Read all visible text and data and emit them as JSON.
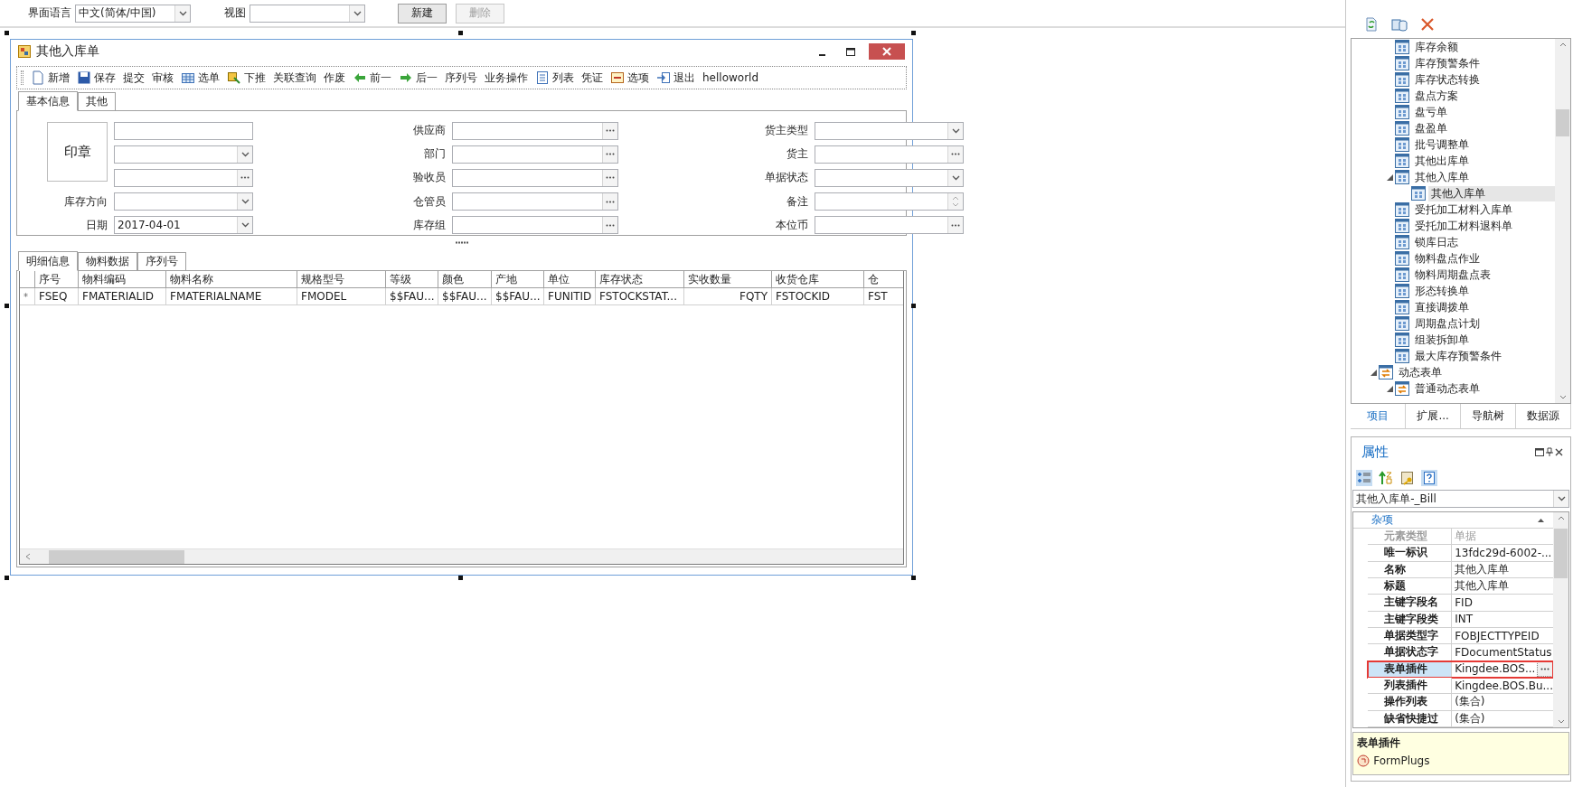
{
  "top_bar": {
    "language_label": "界面语言",
    "language_value": "中文(简体/中国)",
    "view_label": "视图",
    "buttons": [
      {
        "label": "新建",
        "disabled": false
      },
      {
        "label": "删除",
        "disabled": true
      }
    ]
  },
  "form_window": {
    "title": "其他入库单",
    "toolbar": [
      {
        "label": "新增",
        "kind": "document"
      },
      {
        "label": "保存",
        "kind": "disk"
      },
      {
        "label": "提交",
        "kind": "plain"
      },
      {
        "label": "审核",
        "kind": "plain"
      },
      {
        "label": "选单",
        "kind": "grid"
      },
      {
        "label": "下推",
        "kind": "push"
      },
      {
        "label": "关联查询",
        "kind": "plain"
      },
      {
        "label": "作废",
        "kind": "plain"
      },
      {
        "label": "前一",
        "kind": "back"
      },
      {
        "label": "后一",
        "kind": "forward"
      },
      {
        "label": "序列号",
        "kind": "plain"
      },
      {
        "label": "业务操作",
        "kind": "plain"
      },
      {
        "label": "列表",
        "kind": "list"
      },
      {
        "label": "凭证",
        "kind": "plain"
      },
      {
        "label": "选项",
        "kind": "options"
      },
      {
        "label": "退出",
        "kind": "exit"
      },
      {
        "label": "helloworld",
        "kind": "plain"
      }
    ],
    "tabs": [
      {
        "label": "基本信息",
        "selected": true
      },
      {
        "label": "其他",
        "selected": false
      }
    ],
    "stamp": "印章",
    "field_columns": [
      [
        {
          "kind": "text"
        },
        {
          "kind": "combo"
        },
        {
          "kind": "lookup"
        },
        {
          "label": "库存方向",
          "kind": "combo"
        },
        {
          "label": "日期",
          "kind": "combo",
          "value": "2017-04-01"
        }
      ],
      [
        {
          "label": "供应商",
          "kind": "lookup"
        },
        {
          "label": "部门",
          "kind": "lookup"
        },
        {
          "label": "验收员",
          "kind": "lookup"
        },
        {
          "label": "仓管员",
          "kind": "lookup"
        },
        {
          "label": "库存组",
          "kind": "lookup"
        }
      ],
      [
        {
          "label": "货主类型",
          "kind": "combo"
        },
        {
          "label": "货主",
          "kind": "lookup"
        },
        {
          "label": "单据状态",
          "kind": "combo"
        },
        {
          "label": "备注",
          "kind": "spin"
        },
        {
          "label": "本位币",
          "kind": "lookup"
        }
      ]
    ],
    "detail_tabs": [
      {
        "label": "明细信息",
        "selected": true
      },
      {
        "label": "物料数据",
        "selected": false
      },
      {
        "label": "序列号",
        "selected": false
      }
    ],
    "grid": {
      "columns": [
        "序号",
        "物料编码",
        "物料名称",
        "规格型号",
        "等级",
        "颜色",
        "产地",
        "单位",
        "库存状态",
        "实收数量",
        "收货仓库",
        "仓"
      ],
      "rows": [
        {
          "marker": "*",
          "cells": [
            "FSEQ",
            "FMATERIALID",
            "FMATERIALNAME",
            "FMODEL",
            "$$FAU...",
            "$$FAU...",
            "$$FAU...",
            "FUNITID",
            "FSTOCKSTAT...",
            "FQTY",
            "FSTOCKID",
            "FST"
          ]
        }
      ]
    }
  },
  "explorer": {
    "tree": {
      "partial_branch": [
        {
          "label": "库存余额",
          "kind": "bill",
          "selected": false
        },
        {
          "label": "库存预警条件",
          "kind": "bill",
          "selected": false
        },
        {
          "label": "库存状态转换",
          "kind": "bill",
          "selected": false
        },
        {
          "label": "盘点方案",
          "kind": "bill",
          "selected": false
        },
        {
          "label": "盘亏单",
          "kind": "bill",
          "selected": false
        },
        {
          "label": "盘盈单",
          "kind": "bill",
          "selected": false
        },
        {
          "label": "批号调整单",
          "kind": "bill",
          "selected": false
        },
        {
          "label": "其他出库单",
          "kind": "bill",
          "selected": false
        },
        {
          "label": "其他入库单",
          "kind": "bill",
          "selected": false,
          "expanded": true,
          "children": [
            {
              "label": "其他入库单",
              "kind": "bill",
              "selected": true
            }
          ]
        },
        {
          "label": "受托加工材料入库单",
          "kind": "bill",
          "selected": false
        },
        {
          "label": "受托加工材料退料单",
          "kind": "bill",
          "selected": false
        },
        {
          "label": "锁库日志",
          "kind": "bill",
          "selected": false
        },
        {
          "label": "物料盘点作业",
          "kind": "bill",
          "selected": false
        },
        {
          "label": "物料周期盘点表",
          "kind": "bill",
          "selected": false
        },
        {
          "label": "形态转换单",
          "kind": "bill",
          "selected": false
        },
        {
          "label": "直接调拨单",
          "kind": "bill",
          "selected": false
        },
        {
          "label": "周期盘点计划",
          "kind": "bill",
          "selected": false
        },
        {
          "label": "组装拆卸单",
          "kind": "bill",
          "selected": false
        },
        {
          "label": "最大库存预警条件",
          "kind": "bill",
          "selected": false
        }
      ],
      "items": [
        {
          "label": "动态表单",
          "kind": "dynamic",
          "selected": false,
          "expanded": true,
          "children": [
            {
              "label": "普通动态表单",
              "kind": "dynamic",
              "selected": false,
              "expanded": true
            }
          ]
        }
      ]
    },
    "tabs": [
      {
        "label": "项目",
        "selected": true
      },
      {
        "label": "扩展...",
        "selected": false
      },
      {
        "label": "导航树",
        "selected": false
      },
      {
        "label": "数据源",
        "selected": false
      }
    ]
  },
  "properties": {
    "title": "属性",
    "object": "其他入库单-_Bill",
    "category": {
      "label": "杂项",
      "expanded": true
    },
    "rows": [
      {
        "name": "元素类型",
        "value": "单据",
        "disabled": true,
        "selected": false
      },
      {
        "name": "唯一标识",
        "value": "13fdc29d-6002-...",
        "disabled": false,
        "selected": false
      },
      {
        "name": "名称",
        "value": "其他入库单",
        "disabled": false,
        "selected": false
      },
      {
        "name": "标题",
        "value": "其他入库单",
        "disabled": false,
        "selected": false
      },
      {
        "name": "主键字段名",
        "value": "FID",
        "disabled": false,
        "selected": false
      },
      {
        "name": "主键字段类",
        "value": "INT",
        "disabled": false,
        "selected": false
      },
      {
        "name": "单据类型字",
        "value": "FOBJECTTYPEID",
        "disabled": false,
        "selected": false
      },
      {
        "name": "单据状态字",
        "value": "FDocumentStatus",
        "disabled": false,
        "selected": false
      },
      {
        "name": "表单插件",
        "value": "Kingdee.BOS...",
        "disabled": false,
        "selected": true
      },
      {
        "name": "列表插件",
        "value": "Kingdee.BOS.Bu...",
        "disabled": false,
        "selected": false
      },
      {
        "name": "操作列表",
        "value": "(集合)",
        "disabled": false,
        "selected": false
      },
      {
        "name": "缺省快捷过",
        "value": "(集合)",
        "disabled": false,
        "selected": false
      }
    ],
    "description": {
      "title": "表单插件",
      "item": "FormPlugs"
    }
  }
}
